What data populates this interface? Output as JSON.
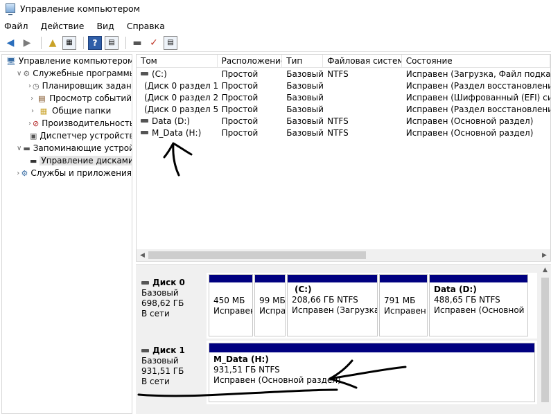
{
  "window": {
    "title": "Управление компьютером"
  },
  "menu": [
    "Файл",
    "Действие",
    "Вид",
    "Справка"
  ],
  "tree": [
    {
      "label": "Управление компьютером (л",
      "icon": "computer-icon",
      "expander": "",
      "indent": 0
    },
    {
      "label": "Служебные программы",
      "icon": "tools-icon",
      "expander": "open",
      "indent": 1
    },
    {
      "label": "Планировщик заданий",
      "icon": "clock-icon",
      "expander": "closed",
      "indent": 2
    },
    {
      "label": "Просмотр событий",
      "icon": "event-viewer-icon",
      "expander": "closed",
      "indent": 2
    },
    {
      "label": "Общие папки",
      "icon": "shared-folder-icon",
      "expander": "closed",
      "indent": 2
    },
    {
      "label": "Производительность",
      "icon": "performance-icon",
      "expander": "closed",
      "indent": 2
    },
    {
      "label": "Диспетчер устройств",
      "icon": "device-manager-icon",
      "expander": "",
      "indent": 2
    },
    {
      "label": "Запоминающие устройст",
      "icon": "storage-icon",
      "expander": "open",
      "indent": 1
    },
    {
      "label": "Управление дисками",
      "icon": "disk-icon",
      "expander": "",
      "indent": 2,
      "selected": true
    },
    {
      "label": "Службы и приложения",
      "icon": "services-icon",
      "expander": "closed",
      "indent": 1
    }
  ],
  "volumes": {
    "columns": [
      "Том",
      "Расположение",
      "Тип",
      "Файловая система",
      "Состояние"
    ],
    "rows": [
      {
        "name": "(C:)",
        "layout": "Простой",
        "type": "Базовый",
        "fs": "NTFS",
        "status": "Исправен (Загрузка, Файл подкачки,"
      },
      {
        "name": "(Диск 0 раздел 1)",
        "layout": "Простой",
        "type": "Базовый",
        "fs": "",
        "status": "Исправен (Раздел восстановления)"
      },
      {
        "name": "(Диск 0 раздел 2)",
        "layout": "Простой",
        "type": "Базовый",
        "fs": "",
        "status": "Исправен (Шифрованный (EFI) систе"
      },
      {
        "name": "(Диск 0 раздел 5)",
        "layout": "Простой",
        "type": "Базовый",
        "fs": "",
        "status": "Исправен (Раздел восстановления)"
      },
      {
        "name": "Data (D:)",
        "layout": "Простой",
        "type": "Базовый",
        "fs": "NTFS",
        "status": "Исправен (Основной раздел)"
      },
      {
        "name": "M_Data (H:)",
        "layout": "Простой",
        "type": "Базовый",
        "fs": "NTFS",
        "status": "Исправен (Основной раздел)"
      }
    ]
  },
  "disks": [
    {
      "name": "Диск 0",
      "kind": "Базовый",
      "size": "698,62 ГБ",
      "state": "В сети",
      "partitions": [
        {
          "title": "",
          "size": "450 МБ",
          "status": "Исправен"
        },
        {
          "title": "",
          "size": "99 МБ",
          "status": "Исправ"
        },
        {
          "title": "(C:)",
          "size": "208,66 ГБ NTFS",
          "status": "Исправен (Загрузка,"
        },
        {
          "title": "",
          "size": "791 МБ",
          "status": "Исправен"
        },
        {
          "title": "Data  (D:)",
          "size": "488,65 ГБ NTFS",
          "status": "Исправен (Основной р"
        }
      ]
    },
    {
      "name": "Диск 1",
      "kind": "Базовый",
      "size": "931,51 ГБ",
      "state": "В сети",
      "partitions": [
        {
          "title": "M_Data  (H:)",
          "size": "931,51 ГБ NTFS",
          "status": "Исправен (Основной раздел)"
        }
      ]
    }
  ],
  "colors": {
    "partition_bar": "#000080",
    "annotation": "#000000"
  }
}
